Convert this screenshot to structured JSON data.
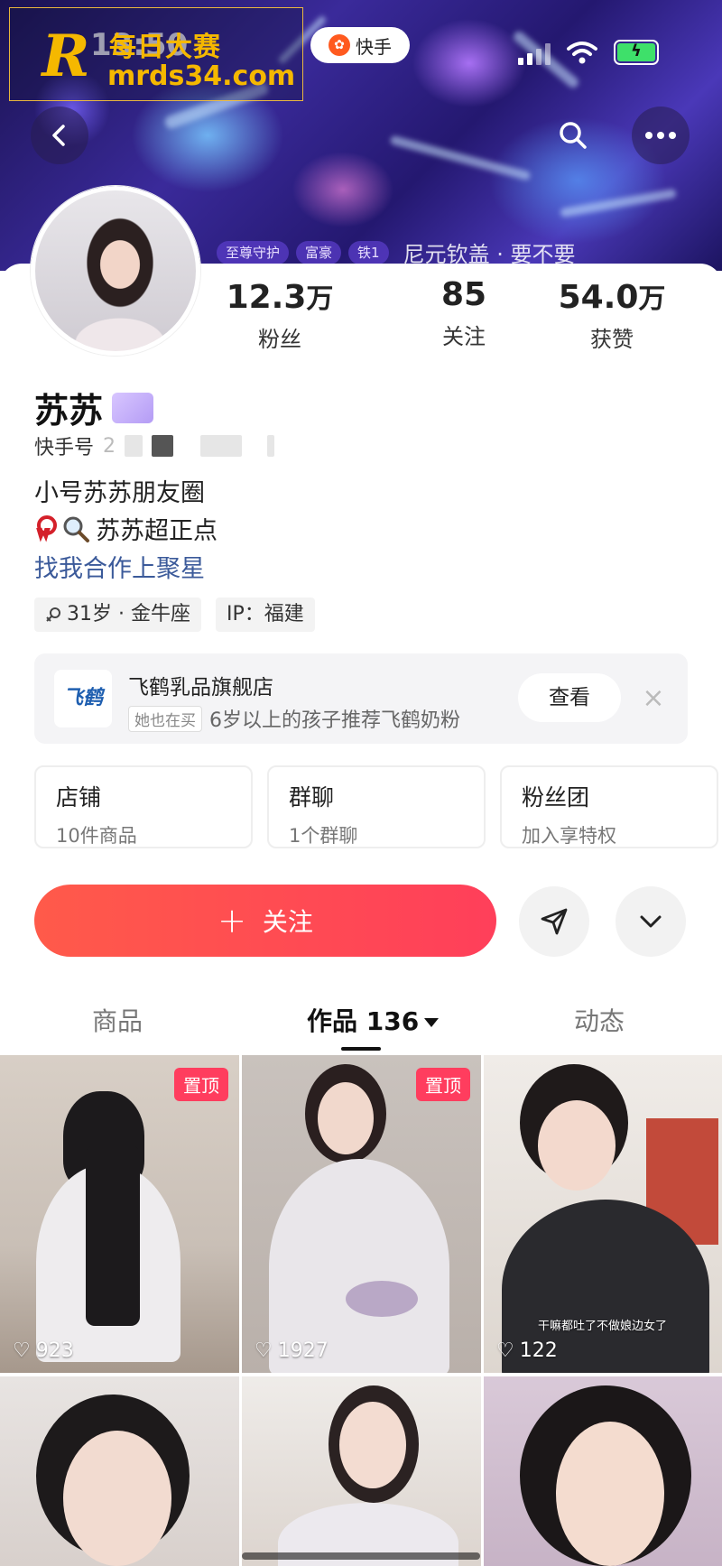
{
  "watermark": {
    "logo_letter": "R",
    "title": "每日大赛",
    "url": "mrds34.com"
  },
  "status_bar": {
    "time": "13:50",
    "app_pill": "快手"
  },
  "hero": {
    "tags": [
      "至尊守护",
      "富豪",
      "铁1"
    ],
    "text": "尼元钦盖 · 要不要"
  },
  "stats": [
    {
      "value": "12.3",
      "unit": "万",
      "label": "粉丝"
    },
    {
      "value": "85",
      "unit": "",
      "label": "关注"
    },
    {
      "value": "54.0",
      "unit": "万",
      "label": "获赞"
    }
  ],
  "profile": {
    "name": "苏苏",
    "ks_id_label": "快手号",
    "ks_id_fragment": "2",
    "bio_line1": "小号苏苏朋友圈",
    "bio_line2": "苏苏超正点",
    "bio_link": "找我合作上聚星",
    "chips": [
      "31岁 · 金牛座",
      "IP：福建"
    ]
  },
  "store": {
    "logo": "飞鹤",
    "name": "飞鹤乳品旗舰店",
    "tag": "她也在买",
    "desc": "6岁以上的孩子推荐飞鹤奶粉",
    "button": "查看",
    "close": "×"
  },
  "features": [
    {
      "title": "店铺",
      "sub": "10件商品"
    },
    {
      "title": "群聊",
      "sub": "1个群聊"
    },
    {
      "title": "粉丝团",
      "sub": "加入享特权"
    }
  ],
  "actions": {
    "follow_plus": "+",
    "follow_label": "关注"
  },
  "tabs": {
    "goods": "商品",
    "works": "作品 136",
    "moments": "动态"
  },
  "works": [
    {
      "likes": "923",
      "pinned": "置顶"
    },
    {
      "likes": "1927",
      "pinned": "置顶"
    },
    {
      "likes": "122",
      "caption": "干嘛都吐了不做娘边女了"
    }
  ],
  "colors": {
    "accent": "#ff4a55",
    "link": "#3b5a9a",
    "pin": "#ff3d5e"
  }
}
